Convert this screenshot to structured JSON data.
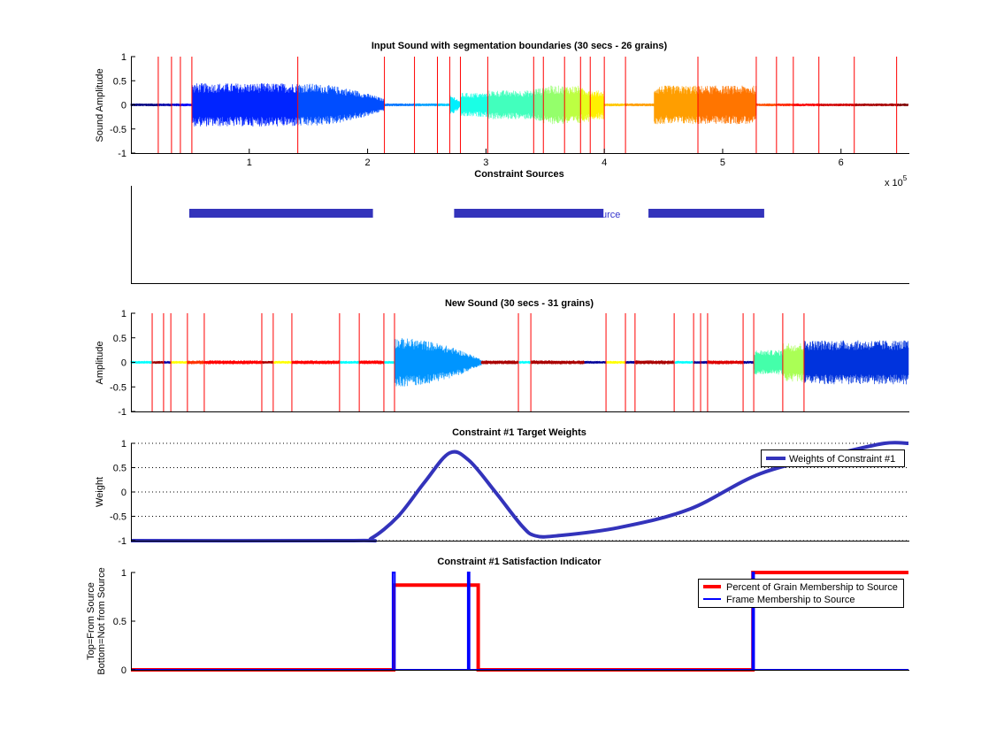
{
  "chart_data": [
    {
      "type": "line",
      "title": "Input Sound with segmentation boundaries (30 secs - 26 grains)",
      "ylabel": "Sound Amplitude",
      "x_multiplier_label": "x 10",
      "x_multiplier_exp": "5",
      "xlim": [
        0,
        6.57
      ],
      "ylim": [
        -1,
        1
      ],
      "xticks": [
        "1",
        "2",
        "3",
        "4",
        "5",
        "6"
      ],
      "yticks": [
        "1",
        "0.5",
        "0",
        "-0.5",
        "-1"
      ],
      "colormap": "jet",
      "boundary_color": "#ff0000",
      "boundaries": [
        0.231,
        0.343,
        0.418,
        0.515,
        1.41,
        2.142,
        2.396,
        2.59,
        2.694,
        2.784,
        3.015,
        3.403,
        3.485,
        3.664,
        3.799,
        3.881,
        4.0,
        4.179,
        4.791,
        5.284,
        5.455,
        5.597,
        5.813,
        6.112,
        6.47
      ],
      "grain_amplitudes": [
        0.03,
        0.03,
        0.03,
        0.03,
        0.45,
        0.45,
        0.03,
        0.03,
        0.03,
        0.2,
        0.25,
        0.3,
        0.35,
        0.4,
        0.4,
        0.35,
        0.3,
        0.03,
        0.4,
        0.4,
        0.03,
        0.03,
        0.03,
        0.03,
        0.03,
        0.03
      ],
      "grain_end_amplitudes": {
        "5": 0.12,
        "9": 0.05
      },
      "grain_onsets": {
        "18": 4.42
      }
    },
    {
      "type": "bar",
      "title": "Constraint Sources",
      "bar_color": "#3333bb",
      "xlim": [
        0,
        6.57
      ],
      "spans": [
        [
          0.493,
          2.045
        ],
        [
          2.731,
          3.993
        ],
        [
          4.373,
          5.351
        ]
      ],
      "legend_fragment": "urce"
    },
    {
      "type": "line",
      "title": "New Sound (30 secs - 31 grains)",
      "ylabel": "Amplitude",
      "xlim": [
        0,
        30
      ],
      "ylim": [
        -1,
        1
      ],
      "yticks": [
        "1",
        "0.5",
        "0",
        "-0.5",
        "-1"
      ],
      "boundary_color": "#ff0000",
      "boundaries": [
        0.82,
        1.26,
        1.54,
        2.18,
        2.83,
        5.05,
        5.49,
        6.21,
        8.05,
        8.81,
        9.76,
        10.17,
        14.95,
        15.43,
        18.33,
        19.08,
        19.45,
        20.96,
        21.71,
        21.98,
        22.25,
        23.62,
        24.03,
        25.15,
        25.97
      ],
      "segments": [
        {
          "start": 0,
          "end": 0.82,
          "color": "#00ffff",
          "amp": 0.03
        },
        {
          "start": 0.82,
          "end": 1.26,
          "color": "#990000",
          "amp": 0.03
        },
        {
          "start": 1.26,
          "end": 1.54,
          "color": "#0000aa",
          "amp": 0.03
        },
        {
          "start": 1.54,
          "end": 2.18,
          "color": "#ffff00",
          "amp": 0.03
        },
        {
          "start": 2.18,
          "end": 2.83,
          "color": "#ff3300",
          "amp": 0.04
        },
        {
          "start": 2.83,
          "end": 5.05,
          "color": "#ff0000",
          "amp": 0.04
        },
        {
          "start": 5.05,
          "end": 5.49,
          "color": "#aa0000",
          "amp": 0.03
        },
        {
          "start": 5.49,
          "end": 6.21,
          "color": "#ffff00",
          "amp": 0.03
        },
        {
          "start": 6.21,
          "end": 8.05,
          "color": "#ff0000",
          "amp": 0.04
        },
        {
          "start": 8.05,
          "end": 8.81,
          "color": "#00ffff",
          "amp": 0.03
        },
        {
          "start": 8.81,
          "end": 9.76,
          "color": "#ff0000",
          "amp": 0.04
        },
        {
          "start": 9.76,
          "end": 10.17,
          "color": "#00ffff",
          "amp": 0.03
        },
        {
          "start": 10.17,
          "end": 13.52,
          "color": "#0095ff",
          "amp": 0.5,
          "end_amp": 0.06
        },
        {
          "start": 13.52,
          "end": 14.95,
          "color": "#aa0000",
          "amp": 0.04
        },
        {
          "start": 14.95,
          "end": 15.43,
          "color": "#00ffff",
          "amp": 0.03
        },
        {
          "start": 15.43,
          "end": 17.51,
          "color": "#aa0000",
          "amp": 0.04
        },
        {
          "start": 17.51,
          "end": 18.33,
          "color": "#000099",
          "amp": 0.03
        },
        {
          "start": 18.33,
          "end": 19.08,
          "color": "#ffff00",
          "amp": 0.03
        },
        {
          "start": 19.08,
          "end": 19.45,
          "color": "#000099",
          "amp": 0.03
        },
        {
          "start": 19.45,
          "end": 20.96,
          "color": "#aa0000",
          "amp": 0.04
        },
        {
          "start": 20.96,
          "end": 21.71,
          "color": "#00ffff",
          "amp": 0.03
        },
        {
          "start": 21.71,
          "end": 22.25,
          "color": "#000099",
          "amp": 0.03
        },
        {
          "start": 22.25,
          "end": 23.62,
          "color": "#dd0000",
          "amp": 0.04
        },
        {
          "start": 23.62,
          "end": 24.03,
          "color": "#000099",
          "amp": 0.03
        },
        {
          "start": 24.03,
          "end": 25.15,
          "color": "#44ffaa",
          "amp": 0.25
        },
        {
          "start": 25.15,
          "end": 25.97,
          "color": "#aaff55",
          "amp": 0.4
        },
        {
          "start": 25.97,
          "end": 30,
          "color": "#0033dd",
          "amp": 0.45
        }
      ]
    },
    {
      "type": "line",
      "title": "Constraint #1 Target Weights",
      "ylabel": "Weight",
      "xlim": [
        0,
        30
      ],
      "ylim": [
        -1,
        1
      ],
      "yticks": [
        "1",
        "0.5",
        "0",
        "-0.5",
        "-1"
      ],
      "grid": "horizontal-dotted",
      "legend_placement": "top-right",
      "series": [
        {
          "name": "Weights of Constraint #1",
          "color": "#3333bb",
          "x": [
            0,
            8.6,
            9.28,
            10.31,
            11.33,
            12.29,
            13.04,
            14.06,
            15.09,
            15.6,
            16.45,
            18.84,
            21.57,
            24.3,
            27.37,
            29.08,
            30
          ],
          "y": [
            -1,
            -1,
            -0.95,
            -0.5,
            0.2,
            0.8,
            0.65,
            0,
            -0.7,
            -0.9,
            -0.9,
            -0.73,
            -0.35,
            0.38,
            0.8,
            1,
            1
          ]
        }
      ]
    },
    {
      "type": "line",
      "title": "Constraint #1 Satisfaction Indicator",
      "ylabel_lines": [
        "Top=From Source",
        "Bottom=Not from Source"
      ],
      "xlim": [
        0,
        30
      ],
      "ylim": [
        0,
        1
      ],
      "yticks": [
        "1",
        "0.5",
        "0"
      ],
      "legend_placement": "top-right",
      "series": [
        {
          "name": "Percent of Grain Membership to Source",
          "color": "#ff0000",
          "x": [
            0,
            10.14,
            10.14,
            13.4,
            13.4,
            24.0,
            24.0,
            30
          ],
          "y": [
            0,
            0,
            0.87,
            0.87,
            0,
            0,
            1,
            1
          ]
        },
        {
          "name": "Frame Membership to Source",
          "color": "#0000ff",
          "x": [
            0,
            10.1,
            10.1,
            10.18,
            10.18,
            13.0,
            13.0,
            13.06,
            13.06,
            23.98,
            23.98,
            24.04,
            24.04,
            30
          ],
          "y": [
            0,
            0,
            1,
            1,
            0,
            0,
            1,
            1,
            0,
            0,
            1,
            1,
            0,
            0
          ]
        }
      ]
    }
  ]
}
